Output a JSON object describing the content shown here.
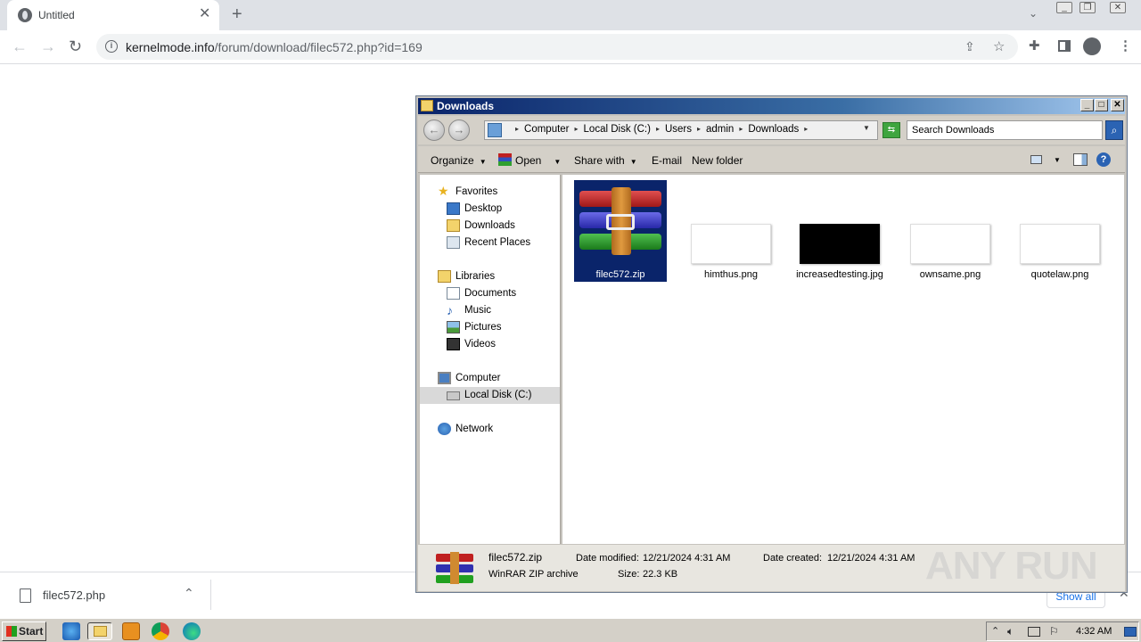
{
  "browser": {
    "tab_title": "Untitled",
    "url_domain": "kernelmode.info",
    "url_path": "/forum/download/filec572.php?id=169"
  },
  "download_bar": {
    "filename": "filec572.php",
    "show_all": "Show all"
  },
  "explorer": {
    "title": "Downloads",
    "breadcrumb": [
      "Computer",
      "Local Disk (C:)",
      "Users",
      "admin",
      "Downloads"
    ],
    "search_placeholder": "Search Downloads",
    "commands": {
      "organize": "Organize",
      "open": "Open",
      "share_with": "Share with",
      "email": "E-mail",
      "new_folder": "New folder"
    },
    "nav": {
      "favorites": "Favorites",
      "desktop": "Desktop",
      "downloads": "Downloads",
      "recent": "Recent Places",
      "libraries": "Libraries",
      "documents": "Documents",
      "music": "Music",
      "pictures": "Pictures",
      "videos": "Videos",
      "computer": "Computer",
      "local_disk": "Local Disk (C:)",
      "network": "Network"
    },
    "files": [
      "filec572.zip",
      "himthus.png",
      "increasedtesting.jpg",
      "ownsame.png",
      "quotelaw.png"
    ],
    "details": {
      "name": "filec572.zip",
      "type": "WinRAR ZIP archive",
      "date_modified_label": "Date modified:",
      "date_modified": "12/21/2024 4:31 AM",
      "size_label": "Size:",
      "size": "22.3 KB",
      "date_created_label": "Date created:",
      "date_created": "12/21/2024 4:31 AM"
    }
  },
  "watermark": "ANY RUN",
  "taskbar": {
    "start": "Start",
    "clock": "4:32 AM"
  }
}
